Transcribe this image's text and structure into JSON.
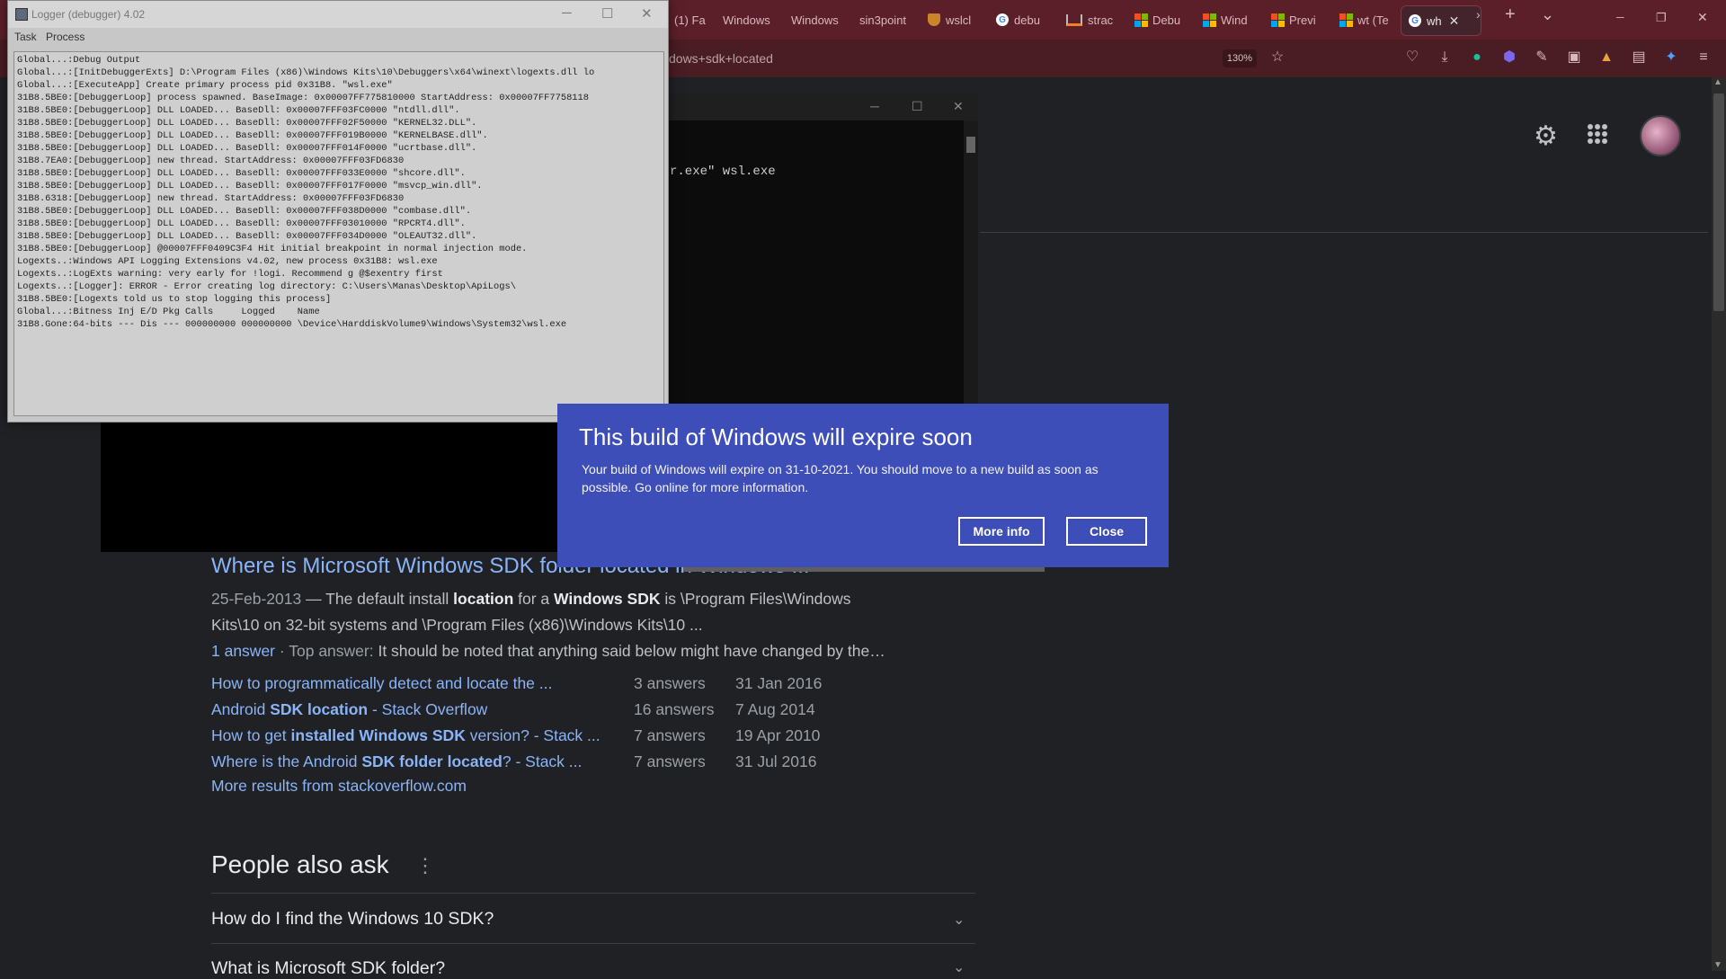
{
  "browser": {
    "tabs": [
      {
        "label": "(1) Fa",
        "icon": "none"
      },
      {
        "label": "Windows",
        "icon": "none"
      },
      {
        "label": "Windows",
        "icon": "none"
      },
      {
        "label": "sin3point",
        "icon": "none"
      },
      {
        "label": "wslcl",
        "icon": "shield-icon"
      },
      {
        "label": "debu",
        "icon": "google-icon"
      },
      {
        "label": "strac",
        "icon": "stack-icon"
      },
      {
        "label": "Debu",
        "icon": "microsoft-icon"
      },
      {
        "label": "Wind",
        "icon": "microsoft-icon"
      },
      {
        "label": "Previ",
        "icon": "microsoft-icon"
      },
      {
        "label": "wt (Te",
        "icon": "microsoft-icon"
      },
      {
        "label": "wh",
        "icon": "google-icon",
        "active": true
      }
    ],
    "tab_close": "✕",
    "new_tab": "+",
    "tab_list": "⌄",
    "window_controls": {
      "minimize": "─",
      "restore": "❐",
      "close": "✕"
    },
    "url_fragment": "dows+sdk+located",
    "zoom": "130%"
  },
  "google": {
    "result": {
      "title": "Where is Microsoft Windows SDK folder located in Windows ...",
      "date": "25-Feb-2013",
      "dash": " — ",
      "snippet_a": "The default install ",
      "snippet_b": "location",
      "snippet_c": " for a ",
      "snippet_d": "Windows SDK",
      "snippet_e": " is \\Program Files\\Windows",
      "snippet_line2": "Kits\\10 on 32-bit systems and \\Program Files (x86)\\Windows Kits\\10 ...",
      "answer_count": "1 answer",
      "top_answer_label": " · Top answer: ",
      "top_answer": "It should be noted that anything said below might have changed by the…"
    },
    "sublinks": [
      {
        "pre": "How to programmatically detect and locate the ...",
        "bold": "",
        "post": "",
        "answers": "3 answers",
        "date": "31 Jan 2016"
      },
      {
        "pre": "Android ",
        "bold": "SDK location",
        "post": " - Stack Overflow",
        "answers": "16 answers",
        "date": "7 Aug 2014"
      },
      {
        "pre": "How to get ",
        "bold": "installed Windows SDK",
        "post": " version? - Stack ...",
        "answers": "7 answers",
        "date": "19 Apr 2010"
      },
      {
        "pre": "Where is the Android ",
        "bold": "SDK folder located",
        "post": "? - Stack ...",
        "answers": "7 answers",
        "date": "31 Jul 2016"
      }
    ],
    "more_results": "More results from stackoverflow.com",
    "people_also_ask": {
      "title": "People also ask",
      "questions": [
        "How do I find the Windows 10 SDK?",
        "What is Microsoft SDK folder?"
      ]
    }
  },
  "console": {
    "text": "r.exe\" wsl.exe"
  },
  "logger": {
    "title": "Logger (debugger) 4.02",
    "menu": [
      "Task",
      "Process"
    ],
    "lines": [
      "Global...:Debug Output",
      "Global...:[InitDebuggerExts] D:\\Program Files (x86)\\Windows Kits\\10\\Debuggers\\x64\\winext\\logexts.dll lo",
      "Global...:[ExecuteApp] Create primary process pid 0x31B8. \"wsl.exe\"",
      "31B8.5BE0:[DebuggerLoop] process spawned. BaseImage: 0x00007FF775810000 StartAddress: 0x00007FF7758118",
      "31B8.5BE0:[DebuggerLoop] DLL LOADED... BaseDll: 0x00007FFF03FC0000 \"ntdll.dll\".",
      "31B8.5BE0:[DebuggerLoop] DLL LOADED... BaseDll: 0x00007FFF02F50000 \"KERNEL32.DLL\".",
      "31B8.5BE0:[DebuggerLoop] DLL LOADED... BaseDll: 0x00007FFF019B0000 \"KERNELBASE.dll\".",
      "31B8.5BE0:[DebuggerLoop] DLL LOADED... BaseDll: 0x00007FFF014F0000 \"ucrtbase.dll\".",
      "31B8.7EA0:[DebuggerLoop] new thread. StartAddress: 0x00007FFF03FD6830",
      "31B8.5BE0:[DebuggerLoop] DLL LOADED... BaseDll: 0x00007FFF033E0000 \"shcore.dll\".",
      "31B8.5BE0:[DebuggerLoop] DLL LOADED... BaseDll: 0x00007FFF017F0000 \"msvcp_win.dll\".",
      "31B8.6318:[DebuggerLoop] new thread. StartAddress: 0x00007FFF03FD6830",
      "31B8.5BE0:[DebuggerLoop] DLL LOADED... BaseDll: 0x00007FFF038D0000 \"combase.dll\".",
      "31B8.5BE0:[DebuggerLoop] DLL LOADED... BaseDll: 0x00007FFF03010000 \"RPCRT4.dll\".",
      "31B8.5BE0:[DebuggerLoop] DLL LOADED... BaseDll: 0x00007FFF034D0000 \"OLEAUT32.dll\".",
      "31B8.5BE0:[DebuggerLoop] @00007FFF0409C3F4 Hit initial breakpoint in normal injection mode.",
      "Logexts..:Windows API Logging Extensions v4.02, new process 0x31B8: wsl.exe",
      "Logexts..:LogExts warning: very early for !logi. Recommend g @$exentry first",
      "Logexts..:[Logger]: ERROR - Error creating log directory: C:\\Users\\Manas\\Desktop\\ApiLogs\\",
      "31B8.5BE0:[Logexts told us to stop logging this process]",
      "Global...:Bitness Inj E/D Pkg Calls     Logged    Name",
      "31B8.Gone:64-bits --- Dis --- 000000000 000000000 \\Device\\HarddiskVolume9\\Windows\\System32\\wsl.exe"
    ]
  },
  "dialog": {
    "title": "This build of Windows will expire soon",
    "body": "Your build of Windows will expire on 31-10-2021. You should move to a new build as soon as possible. Go online for more information.",
    "more_info": "More info",
    "close": "Close"
  },
  "colors": {
    "tabstrip": "#5b1f2a",
    "toolbar": "#4a1c24",
    "page_bg": "#202124",
    "link": "#8ab4f8",
    "dialog_bg": "#3e4eb8"
  }
}
